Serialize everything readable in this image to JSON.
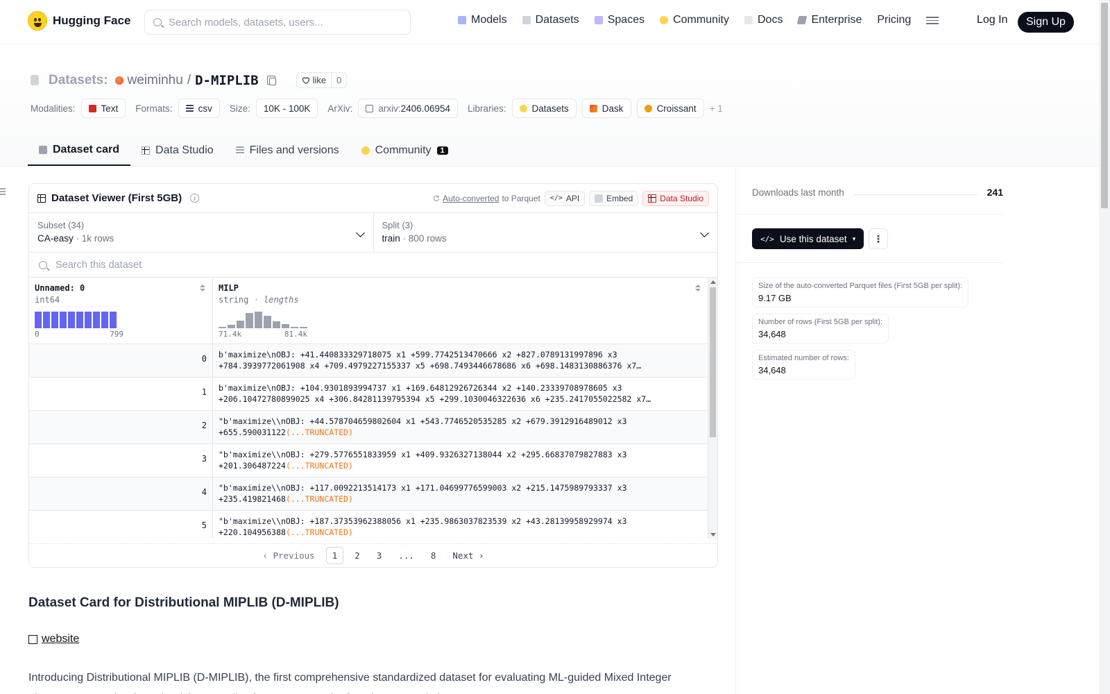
{
  "nav": {
    "brand": "Hugging Face",
    "search_placeholder": "Search models, datasets, users...",
    "links": [
      "Models",
      "Datasets",
      "Spaces",
      "Community",
      "Docs",
      "Enterprise",
      "Pricing"
    ],
    "login": "Log In",
    "signup": "Sign Up"
  },
  "header": {
    "section": "Datasets:",
    "owner": "weiminhu",
    "slash": "/",
    "repo": "D-MIPLIB",
    "like_label": "like",
    "like_count": "0",
    "modalities_label": "Modalities:",
    "modality": "Text",
    "formats_label": "Formats:",
    "format": "csv",
    "size_label": "Size:",
    "size": "10K - 100K",
    "arxiv_label": "ArXiv:",
    "arxiv_prefix": "arxiv:",
    "arxiv_id": "2406.06954",
    "libraries_label": "Libraries:",
    "libraries": [
      "Datasets",
      "Dask",
      "Croissant"
    ],
    "libraries_more": "+ 1"
  },
  "tabs": {
    "card": "Dataset card",
    "studio": "Data Studio",
    "files": "Files and versions",
    "community": "Community",
    "community_count": "1"
  },
  "viewer": {
    "title": "Dataset Viewer (First 5GB)",
    "info": "i",
    "autoconv_link": "Auto-converted",
    "autoconv_rest": "to Parquet",
    "api": "API",
    "embed": "Embed",
    "data_studio": "Data Studio",
    "subset_label": "Subset (34)",
    "subset_value": "CA-easy",
    "subset_rows": "1k rows",
    "split_label": "Split (3)",
    "split_value": "train",
    "split_rows": "800 rows",
    "dot": "·",
    "search_placeholder": "Search this dataset",
    "col1": {
      "name": "Unnamed: 0",
      "type": "int64",
      "min": "0",
      "max": "799"
    },
    "col2": {
      "name": "MILP",
      "type": "string",
      "sub": "lengths",
      "min": "71.4k",
      "max": "81.4k"
    },
    "rows": [
      {
        "idx": "0",
        "l1": "b'maximize\\nOBJ: +41.440833329718075 x1 +599.7742513470666 x2 +827.0789131997896 x3",
        "l2": "+784.3939772061908 x4 +709.4979227155337 x5 +698.7493446678686 x6 +698.1483130886376 x7…",
        "trunc": ""
      },
      {
        "idx": "1",
        "l1": "b'maximize\\nOBJ: +104.9301893994737 x1 +169.64812926726344 x2 +140.23339708978605 x3",
        "l2": "+206.10472780899025 x4 +306.84281139795394 x5 +299.1030046322636 x6 +235.2417055022582 x7…",
        "trunc": ""
      },
      {
        "idx": "2",
        "l1": "\"b'maximize\\\\nOBJ: +44.578704659802604 x1 +543.7746520535285 x2 +679.3912916489012 x3",
        "l2": "+655.590031122",
        "trunc": "(...TRUNCATED)"
      },
      {
        "idx": "3",
        "l1": "\"b'maximize\\\\nOBJ: +279.5776551833959 x1 +409.9326327138044 x2 +295.66837079827883 x3",
        "l2": "+201.306487224",
        "trunc": "(...TRUNCATED)"
      },
      {
        "idx": "4",
        "l1": "\"b'maximize\\\\nOBJ: +117.0092213514173 x1 +171.04699776599003 x2 +215.1475989793337 x3",
        "l2": "+235.419821468",
        "trunc": "(...TRUNCATED)"
      },
      {
        "idx": "5",
        "l1": "\"b'maximize\\\\nOBJ: +187.37353962388056 x1 +235.9863037823539 x2 +43.28139958929974 x3",
        "l2": "+220.104956388",
        "trunc": "(...TRUNCATED)"
      }
    ],
    "pager": {
      "prev": "Previous",
      "pages": [
        "1",
        "2",
        "3",
        "...",
        "8"
      ],
      "next": "Next"
    }
  },
  "card": {
    "title": "Dataset Card for Distributional MIPLIB (D-MIPLIB)",
    "link": "website",
    "intro": "Introducing Distributional MIPLIB (D-MIPLIB), the first comprehensive standardized dataset for evaluating ML-guided Mixed Integer Linear Programming (MILP) solving. Details of D-MIPLIB can be found on our website."
  },
  "sidebar": {
    "downloads_label": "Downloads last month",
    "downloads": "241",
    "use_button": "Use this dataset",
    "more": "⋮",
    "stats": [
      {
        "label": "Size of the auto-converted Parquet files (First 5GB per split):",
        "value": "9.17 GB"
      },
      {
        "label": "Number of rows (First 5GB per split):",
        "value": "34,648"
      },
      {
        "label": "Estimated number of rows:",
        "value": "34,648"
      }
    ]
  },
  "histograms": {
    "col1_levels": [
      1,
      1,
      1,
      1,
      1,
      1,
      1,
      1,
      1,
      1
    ],
    "col2_levels": [
      0.08,
      0.2,
      0.45,
      0.92,
      1.0,
      0.75,
      0.42,
      0.25,
      0.08,
      0.05
    ]
  }
}
